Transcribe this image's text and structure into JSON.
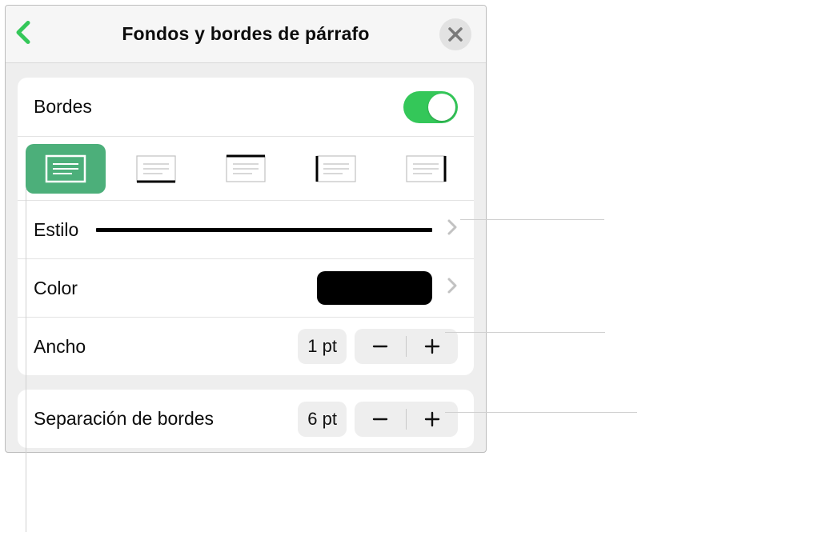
{
  "header": {
    "title": "Fondos y bordes de párrafo"
  },
  "borders": {
    "toggle_label": "Bordes",
    "enabled": true,
    "positions": {
      "all": "border-all",
      "bottom": "border-bottom",
      "top": "border-top",
      "left": "border-left",
      "right": "border-right"
    },
    "style_label": "Estilo",
    "color_label": "Color",
    "color_value": "#000000",
    "width_label": "Ancho",
    "width_value": "1 pt",
    "offset_label": "Separación de bordes",
    "offset_value": "6 pt"
  }
}
